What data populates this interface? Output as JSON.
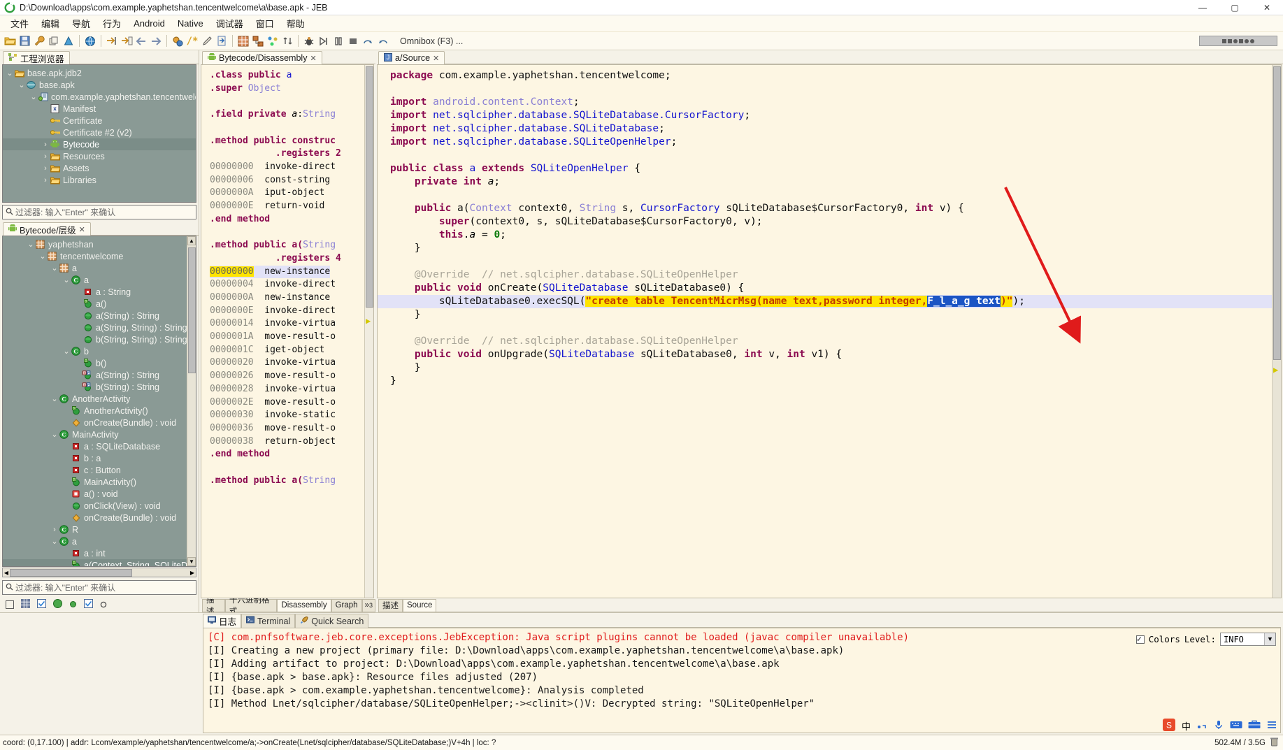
{
  "window": {
    "title": "D:\\Download\\apps\\com.example.yaphetshan.tencentwelcome\\a\\base.apk - JEB",
    "app_icon": "jeb-logo-icon",
    "minimize": "—",
    "maximize": "▢",
    "close": "✕"
  },
  "menu": [
    "文件",
    "编辑",
    "导航",
    "行为",
    "Android",
    "Native",
    "调试器",
    "窗口",
    "帮助"
  ],
  "toolbar": {
    "omnibox_hint": "Omnibox (F3) ...",
    "buttons": [
      "open-folder-icon",
      "save-icon",
      "wrench-icon",
      "copy-icon",
      "warning-icon",
      "globe-icon",
      "goto-icon",
      "goto-back-icon",
      "back-arrow-icon",
      "forward-arrow-icon",
      "refactor-icon",
      "comment-icon",
      "edit-pencil-icon",
      "export-icon",
      "table-icon",
      "graph-icon",
      "nodes-icon",
      "sort-icon",
      "debug-bug-icon",
      "run-icon",
      "pause-icon",
      "stop-icon",
      "step-over-icon",
      "step-into-icon"
    ]
  },
  "project_explorer": {
    "tab_label": "工程浏览器",
    "tab_icon": "project-tree-icon",
    "filter_placeholder": "过滤器: 输入\"Enter\" 来确认",
    "tree": [
      {
        "depth": 0,
        "arrow": "v",
        "icon": "folder-icon",
        "label": "base.apk.jdb2",
        "selected": false
      },
      {
        "depth": 1,
        "arrow": "v",
        "icon": "apk-bundle-icon",
        "label": "base.apk",
        "selected": false
      },
      {
        "depth": 2,
        "arrow": "v",
        "icon": "android-package-icon",
        "label": "com.example.yaphetshan.tencentwelcome",
        "selected": false
      },
      {
        "depth": 3,
        "arrow": "",
        "icon": "manifest-xml-icon",
        "label": "Manifest",
        "selected": false
      },
      {
        "depth": 3,
        "arrow": "",
        "icon": "key-icon",
        "label": "Certificate",
        "selected": false
      },
      {
        "depth": 3,
        "arrow": "",
        "icon": "key-icon",
        "label": "Certificate #2 (v2)",
        "selected": false
      },
      {
        "depth": 3,
        "arrow": ">",
        "icon": "android-robot-icon",
        "label": "Bytecode",
        "selected": true
      },
      {
        "depth": 3,
        "arrow": ">",
        "icon": "folder-icon",
        "label": "Resources",
        "selected": false
      },
      {
        "depth": 3,
        "arrow": ">",
        "icon": "folder-icon",
        "label": "Assets",
        "selected": false
      },
      {
        "depth": 3,
        "arrow": ">",
        "icon": "folder-icon",
        "label": "Libraries",
        "selected": false
      }
    ]
  },
  "hierarchy": {
    "tab_label": "Bytecode/层级",
    "tab_icon": "android-robot-icon",
    "filter_placeholder": "过滤器: 输入\"Enter\" 来确认",
    "tree": [
      {
        "depth": 2,
        "arrow": "v",
        "icon": "package-icon",
        "label": "yaphetshan",
        "selected": false
      },
      {
        "depth": 3,
        "arrow": "v",
        "icon": "package-icon",
        "label": "tencentwelcome",
        "selected": false
      },
      {
        "depth": 4,
        "arrow": "v",
        "icon": "package-icon",
        "label": "a",
        "selected": false
      },
      {
        "depth": 5,
        "arrow": "v",
        "icon": "class-icon",
        "label": "a",
        "selected": false
      },
      {
        "depth": 6,
        "arrow": "",
        "icon": "field-private-icon",
        "label": "a : String",
        "selected": false
      },
      {
        "depth": 6,
        "arrow": "",
        "icon": "constructor-icon",
        "label": "a()",
        "selected": false
      },
      {
        "depth": 6,
        "arrow": "",
        "icon": "method-public-icon",
        "label": "a(String) : String",
        "selected": false
      },
      {
        "depth": 6,
        "arrow": "",
        "icon": "method-public-icon",
        "label": "a(String, String) : String",
        "selected": false
      },
      {
        "depth": 6,
        "arrow": "",
        "icon": "method-public-icon",
        "label": "b(String, String) : String",
        "selected": false
      },
      {
        "depth": 5,
        "arrow": "v",
        "icon": "class-icon",
        "label": "b",
        "selected": false
      },
      {
        "depth": 6,
        "arrow": "",
        "icon": "constructor-icon",
        "label": "b()",
        "selected": false
      },
      {
        "depth": 6,
        "arrow": "",
        "icon": "method-static-final-icon",
        "label": "a(String) : String",
        "selected": false
      },
      {
        "depth": 6,
        "arrow": "",
        "icon": "method-static-final-icon",
        "label": "b(String) : String",
        "selected": false
      },
      {
        "depth": 4,
        "arrow": "v",
        "icon": "class-icon",
        "label": "AnotherActivity",
        "selected": false
      },
      {
        "depth": 5,
        "arrow": "",
        "icon": "constructor-icon",
        "label": "AnotherActivity()",
        "selected": false
      },
      {
        "depth": 5,
        "arrow": "",
        "icon": "method-override-icon",
        "label": "onCreate(Bundle) : void",
        "selected": false
      },
      {
        "depth": 4,
        "arrow": "v",
        "icon": "class-icon",
        "label": "MainActivity",
        "selected": false
      },
      {
        "depth": 5,
        "arrow": "",
        "icon": "field-private-icon",
        "label": "a : SQLiteDatabase",
        "selected": false
      },
      {
        "depth": 5,
        "arrow": "",
        "icon": "field-private-icon",
        "label": "b : a",
        "selected": false
      },
      {
        "depth": 5,
        "arrow": "",
        "icon": "field-private-icon",
        "label": "c : Button",
        "selected": false
      },
      {
        "depth": 5,
        "arrow": "",
        "icon": "constructor-icon",
        "label": "MainActivity()",
        "selected": false
      },
      {
        "depth": 5,
        "arrow": "",
        "icon": "method-private-icon",
        "label": "a() : void",
        "selected": false
      },
      {
        "depth": 5,
        "arrow": "",
        "icon": "method-public-icon",
        "label": "onClick(View) : void",
        "selected": false
      },
      {
        "depth": 5,
        "arrow": "",
        "icon": "method-override-icon",
        "label": "onCreate(Bundle) : void",
        "selected": false
      },
      {
        "depth": 4,
        "arrow": ">",
        "icon": "class-icon",
        "label": "R",
        "selected": false
      },
      {
        "depth": 4,
        "arrow": "v",
        "icon": "class-icon",
        "label": "a",
        "selected": false
      },
      {
        "depth": 5,
        "arrow": "",
        "icon": "field-private-icon",
        "label": "a : int",
        "selected": false
      },
      {
        "depth": 5,
        "arrow": "",
        "icon": "constructor-icon",
        "label": "a(Context, String, SQLiteDatab",
        "selected": true
      }
    ]
  },
  "bytecode_panel": {
    "tab_label": "Bytecode/Disassembly",
    "tab_icon": "android-robot-icon",
    "close_icon": "close-icon",
    "bottom_tabs": [
      {
        "label": "描述",
        "active": false
      },
      {
        "label": "十六进制格式",
        "active": false
      },
      {
        "label": "Disassembly",
        "active": true
      },
      {
        "label": "Graph",
        "active": false
      },
      {
        "label": "»",
        "active": false,
        "badge": "3"
      }
    ],
    "lines": [
      {
        "addr": "",
        "text": ".class public a",
        "kind": "decl-class"
      },
      {
        "addr": "",
        "text": ".super Object",
        "kind": "decl-super"
      },
      {
        "addr": "",
        "text": "",
        "kind": "blank"
      },
      {
        "addr": "",
        "text": ".field private a:String",
        "kind": "decl-field"
      },
      {
        "addr": "",
        "text": "",
        "kind": "blank"
      },
      {
        "addr": "",
        "text": ".method public construc",
        "kind": "decl-method"
      },
      {
        "addr": "",
        "text": "        .registers 2",
        "kind": "registers"
      },
      {
        "addr": "00000000",
        "text": "invoke-direct",
        "kind": "insn"
      },
      {
        "addr": "00000006",
        "text": "const-string",
        "kind": "insn"
      },
      {
        "addr": "0000000A",
        "text": "iput-object",
        "kind": "insn"
      },
      {
        "addr": "0000000E",
        "text": "return-void",
        "kind": "insn"
      },
      {
        "addr": "",
        "text": ".end method",
        "kind": "decl"
      },
      {
        "addr": "",
        "text": "",
        "kind": "blank"
      },
      {
        "addr": "",
        "text": ".method public a(String",
        "kind": "decl-method2"
      },
      {
        "addr": "",
        "text": "        .registers 4",
        "kind": "registers"
      },
      {
        "addr": "00000000",
        "text": "new-instance",
        "kind": "insn-hl"
      },
      {
        "addr": "00000004",
        "text": "invoke-direct",
        "kind": "insn"
      },
      {
        "addr": "0000000A",
        "text": "new-instance",
        "kind": "insn"
      },
      {
        "addr": "0000000E",
        "text": "invoke-direct",
        "kind": "insn"
      },
      {
        "addr": "00000014",
        "text": "invoke-virtua",
        "kind": "insn"
      },
      {
        "addr": "0000001A",
        "text": "move-result-o",
        "kind": "insn"
      },
      {
        "addr": "0000001C",
        "text": "iget-object",
        "kind": "insn"
      },
      {
        "addr": "00000020",
        "text": "invoke-virtua",
        "kind": "insn"
      },
      {
        "addr": "00000026",
        "text": "move-result-o",
        "kind": "insn"
      },
      {
        "addr": "00000028",
        "text": "invoke-virtua",
        "kind": "insn"
      },
      {
        "addr": "0000002E",
        "text": "move-result-o",
        "kind": "insn"
      },
      {
        "addr": "00000030",
        "text": "invoke-static",
        "kind": "insn"
      },
      {
        "addr": "00000036",
        "text": "move-result-o",
        "kind": "insn"
      },
      {
        "addr": "00000038",
        "text": "return-object",
        "kind": "insn"
      },
      {
        "addr": "",
        "text": ".end method",
        "kind": "decl"
      },
      {
        "addr": "",
        "text": "",
        "kind": "blank"
      },
      {
        "addr": "",
        "text": ".method public a(String",
        "kind": "decl-method2"
      }
    ]
  },
  "source_panel": {
    "tab_label": "a/Source",
    "tab_icon": "java-source-icon",
    "close_icon": "close-icon",
    "bottom_tabs": [
      {
        "label": "描述",
        "active": false
      },
      {
        "label": "Source",
        "active": true
      }
    ],
    "code": {
      "package": "com.example.yaphetshan.tencentwelcome",
      "imports": [
        "android.content.Context",
        "net.sqlcipher.database.SQLiteDatabase.CursorFactory",
        "net.sqlcipher.database.SQLiteDatabase",
        "net.sqlcipher.database.SQLiteOpenHelper"
      ],
      "class_decl": "public class a extends SQLiteOpenHelper {",
      "field": "private int a;",
      "ctor_sig": "public a(Context context0, String s, CursorFactory sQLiteDatabase$CursorFactory0, int v) {",
      "ctor_super": "super(context0, s, sQLiteDatabase$CursorFactory0, v);",
      "ctor_assign": "this.a = 0;",
      "override_comment": "@Override  // net.sqlcipher.database.SQLiteOpenHelper",
      "oncreate_sig": "public void onCreate(SQLiteDatabase sQLiteDatabase0) {",
      "exec_prefix": "sQLiteDatabase0.execSQL(",
      "exec_str_plain": "\"create table TencentMicrMsg(name text,password integer,",
      "exec_str_selected": "F_l_a_g text",
      "exec_str_tail": ")\"",
      "exec_suffix": ");",
      "onupgrade_sig": "public void onUpgrade(SQLiteDatabase sQLiteDatabase0, int v, int v1) {"
    }
  },
  "console": {
    "tabs": [
      {
        "label": "日志",
        "icon": "log-icon",
        "active": true
      },
      {
        "label": "Terminal",
        "icon": "terminal-icon",
        "active": false
      },
      {
        "label": "Quick Search",
        "icon": "rocket-icon",
        "active": false
      }
    ],
    "colors_label": "Colors",
    "colors_checked": true,
    "level_label": "Level:",
    "level_value": "INFO",
    "lines": [
      {
        "tag": "[C]",
        "severity": "error",
        "text": "com.pnfsoftware.jeb.core.exceptions.JebException: Java script plugins cannot be loaded (javac compiler unavailable)"
      },
      {
        "tag": "[I]",
        "severity": "info",
        "text": "Creating a new project (primary file: D:\\Download\\apps\\com.example.yaphetshan.tencentwelcome\\a\\base.apk)"
      },
      {
        "tag": "[I]",
        "severity": "info",
        "text": "Adding artifact to project: D:\\Download\\apps\\com.example.yaphetshan.tencentwelcome\\a\\base.apk"
      },
      {
        "tag": "[I]",
        "severity": "info",
        "text": "{base.apk > base.apk}: Resource files adjusted (207)"
      },
      {
        "tag": "[I]",
        "severity": "info",
        "text": "{base.apk > com.example.yaphetshan.tencentwelcome}: Analysis completed"
      },
      {
        "tag": "[I]",
        "severity": "info",
        "text": "Method Lnet/sqlcipher/database/SQLiteOpenHelper;-><clinit>()V: Decrypted string: \"SQLiteOpenHelper\""
      }
    ]
  },
  "statusbar": {
    "text": "coord: (0,17.100) | addr: Lcom/example/yaphetshan/tencentwelcome/a;->onCreate(Lnet/sqlcipher/database/SQLiteDatabase;)V+4h | loc: ?",
    "memory": "502.4M / 3.5G"
  },
  "tray": {
    "items": [
      "sogou-icon",
      "中",
      "period-icon",
      "mic-icon",
      "keyboard-icon",
      "toolbox-icon",
      "settings-icon",
      "more-icon"
    ]
  },
  "colors": {
    "tree_bg": "#8a9a95",
    "code_bg": "#fdf6e3",
    "string_highlight": "#ffe400",
    "selection_blue": "#1b54c4",
    "error_red": "#e01b1b",
    "annotation_arrow": "#e01b1b"
  }
}
